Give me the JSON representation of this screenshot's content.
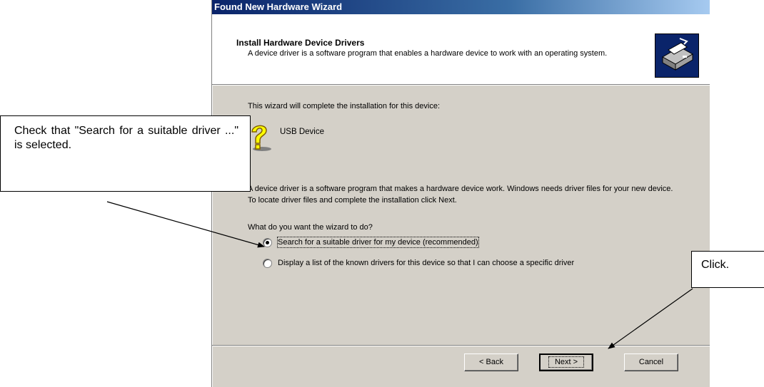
{
  "window": {
    "title": "Found New Hardware Wizard"
  },
  "header": {
    "title": "Install Hardware Device Drivers",
    "description": "A device driver is a software program that enables a hardware device to work with an operating system.",
    "icon": "hardware-wizard-icon"
  },
  "body": {
    "intro": "This wizard will complete the installation for this device:",
    "device_name": "USB Device",
    "device_icon": "unknown-device-question-icon",
    "explanation": "A device driver is a software program that makes a hardware device work. Windows needs driver files for your new device. To locate driver files and complete the installation click Next.",
    "question": "What do you want the wizard to do?",
    "options": [
      {
        "label": "Search for a suitable driver for my device (recommended)",
        "selected": true
      },
      {
        "label": "Display a list of the known drivers for this device so that I can choose a specific driver",
        "selected": false
      }
    ]
  },
  "buttons": {
    "back": "< Back",
    "next": "Next >",
    "cancel": "Cancel"
  },
  "annotations": {
    "left_callout": "Check that \"Search for a suitable driver ...\" is selected.",
    "right_callout": "Click."
  },
  "colors": {
    "title_gradient_start": "#0a246a",
    "title_gradient_end": "#a6caf0",
    "dialog_face": "#d4d0c8"
  }
}
